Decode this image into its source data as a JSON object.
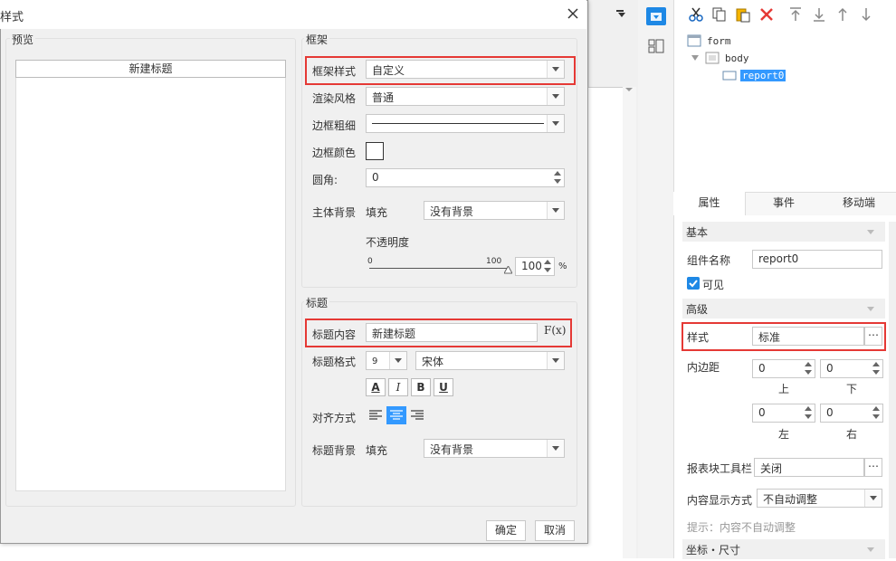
{
  "dialog": {
    "title": "样式",
    "preview_label": "预览",
    "preview_title": "新建标题",
    "frame_group": "框架",
    "frame_style_label": "框架样式",
    "frame_style_value": "自定义",
    "render_label": "渲染风格",
    "render_value": "普通",
    "border_width_label": "边框粗细",
    "border_color_label": "边框颜色",
    "radius_label": "圆角:",
    "radius_value": "0",
    "body_bg_label": "主体背景",
    "fill_label": "填充",
    "body_bg_value": "没有背景",
    "opacity_label": "不透明度",
    "opacity_min": "0",
    "opacity_max": "100",
    "opacity_value": "100",
    "opacity_unit": "%",
    "title_group": "标题",
    "title_content_label": "标题内容",
    "title_content_value": "新建标题",
    "formula_btn": "F(x)",
    "title_format_label": "标题格式",
    "font_size": "9",
    "font_name": "宋体",
    "font_color_btn": "A",
    "italic_btn": "I",
    "bold_btn": "B",
    "underline_btn": "U",
    "align_label": "对齐方式",
    "title_bg_label": "标题背景",
    "title_fill_label": "填充",
    "title_bg_value": "没有背景",
    "ok": "确定",
    "cancel": "取消"
  },
  "right_panel": {
    "tree": [
      "form",
      "body",
      "report0"
    ],
    "tabs": [
      "属性",
      "事件",
      "移动端"
    ],
    "basic_section": "基本",
    "name_label": "组件名称",
    "name_value": "report0",
    "visible_label": "可见",
    "advanced_section": "高级",
    "style_label": "样式",
    "style_value": "标准",
    "padding_label": "内边距",
    "pad_top": "0",
    "pad_bottom": "0",
    "pad_left": "0",
    "pad_right": "0",
    "up_label": "上",
    "down_label": "下",
    "left_label": "左",
    "right_label": "右",
    "toolbar_label": "报表块工具栏",
    "toolbar_value": "关闭",
    "display_label": "内容显示方式",
    "display_value": "不自动调整",
    "hint": "提示：内容不自动调整",
    "coord_section": "坐标・尺寸"
  },
  "colors": {
    "accent": "#1e88e5",
    "highlight": "#e53935",
    "selected_bg": "#3399ff"
  }
}
